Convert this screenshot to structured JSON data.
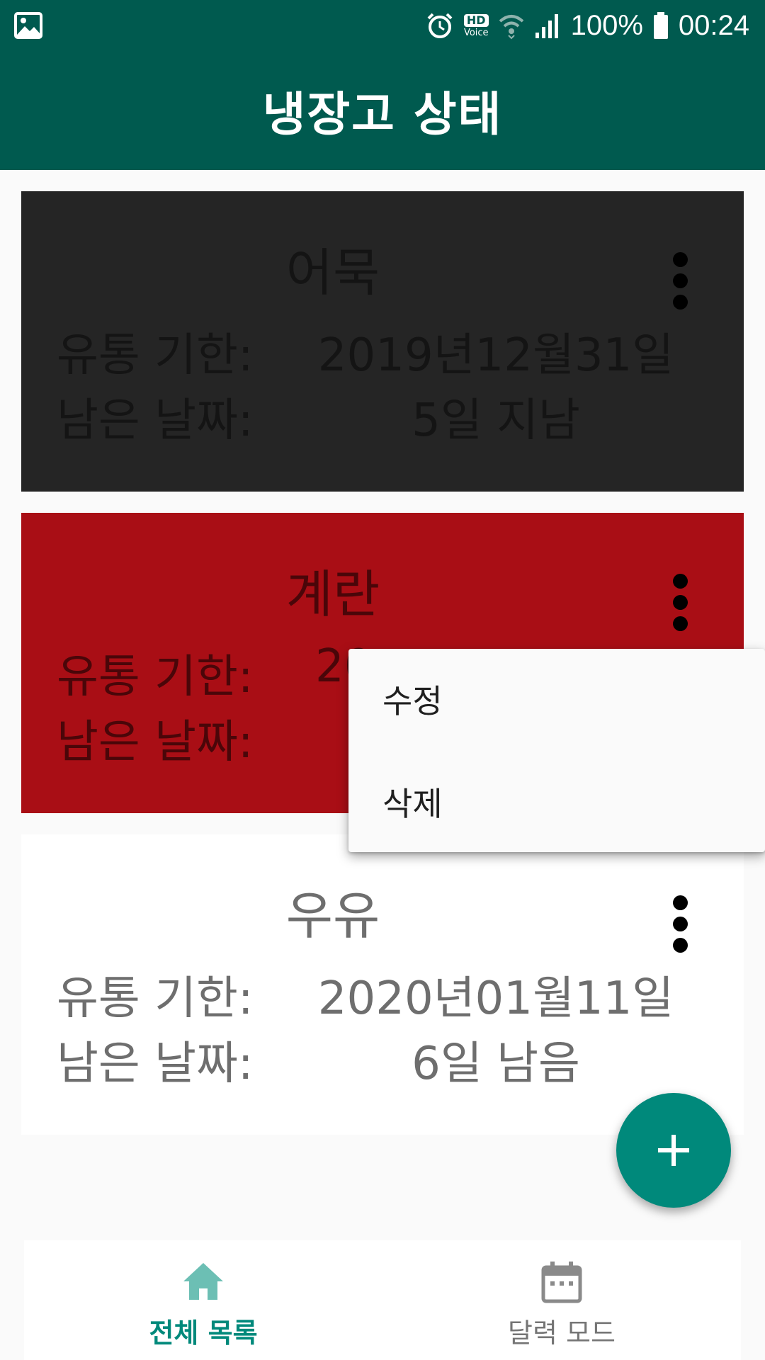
{
  "status_bar": {
    "icons": [
      "image-icon",
      "alarm-icon",
      "hd-voice-icon",
      "wifi-icon",
      "signal-icon",
      "battery-icon"
    ],
    "hd_label": "HD",
    "voice_label": "Voice",
    "battery": "100%",
    "time": "00:24"
  },
  "app_bar": {
    "title": "냉장고 상태"
  },
  "labels": {
    "expiry": "유통 기한:",
    "remaining": "남은 날짜:"
  },
  "items": [
    {
      "name": "어묵",
      "expiry": "2019년12월31일",
      "remaining": "5일 지남",
      "color": "#252525"
    },
    {
      "name": "계란",
      "expiry": "20",
      "remaining": "",
      "color": "#a90e15"
    },
    {
      "name": "우유",
      "expiry": "2020년01월11일",
      "remaining": "6일 남음",
      "color": "#ffffff"
    }
  ],
  "popup_menu": {
    "items": [
      "수정",
      "삭제"
    ]
  },
  "fab": {
    "icon": "plus-icon"
  },
  "bottom_nav": {
    "items": [
      {
        "label": "전체 목록",
        "icon": "home-icon",
        "active": true,
        "color": "#00897b"
      },
      {
        "label": "달력 모드",
        "icon": "calendar-icon",
        "active": false,
        "color": "#757575"
      }
    ]
  },
  "colors": {
    "primary": "#005a4f",
    "accent": "#00897b"
  }
}
